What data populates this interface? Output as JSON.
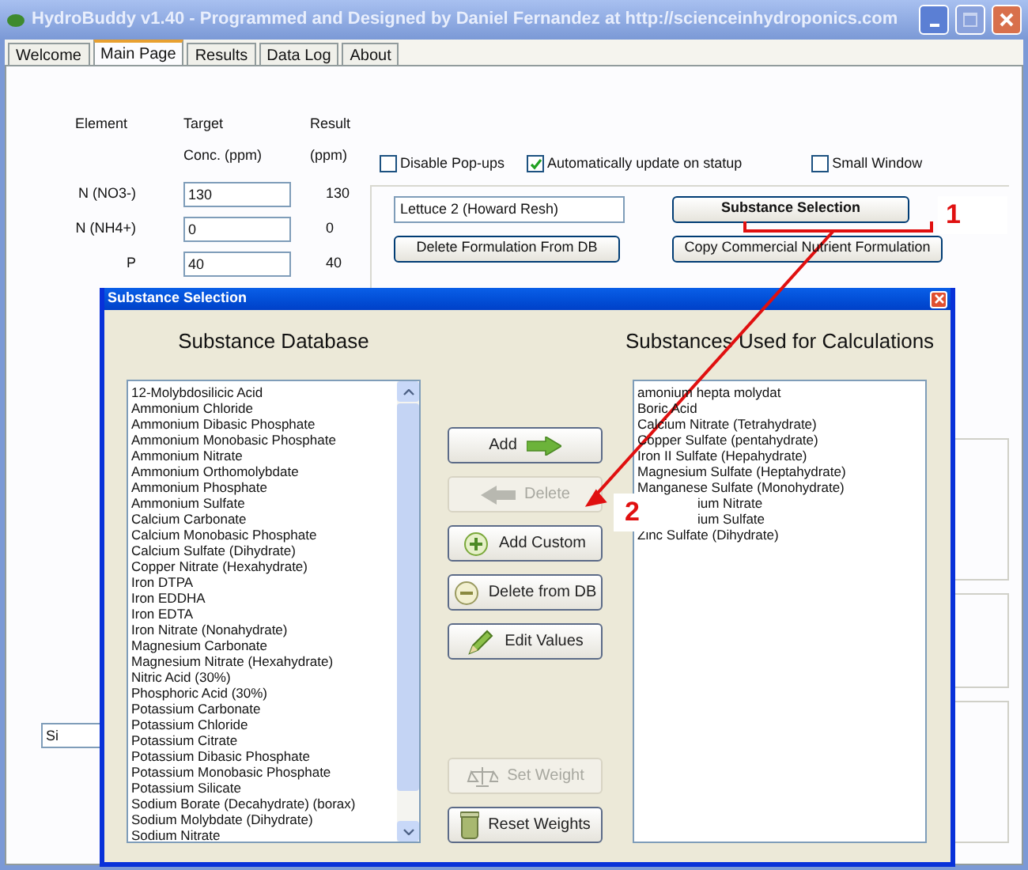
{
  "window": {
    "title": "HydroBuddy v1.40 - Programmed and Designed by Daniel Fernandez at http://scienceinhydroponics.com"
  },
  "tabs": [
    {
      "label": "Welcome",
      "selected": false
    },
    {
      "label": "Main Page",
      "selected": true
    },
    {
      "label": "Results",
      "selected": false
    },
    {
      "label": "Data Log",
      "selected": false
    },
    {
      "label": "About",
      "selected": false
    }
  ],
  "main_page": {
    "columns": [
      {
        "line_1": "Element"
      },
      {
        "line_1": "Target",
        "line_2": "Conc. (ppm)"
      },
      {
        "line_1": "Result",
        "line_2": "(ppm)"
      }
    ],
    "rows": [
      {
        "element": "N (NO3-)",
        "target": "130",
        "result": "130"
      },
      {
        "element": "N (NH4+)",
        "target": "0",
        "result": "0"
      },
      {
        "element": "P",
        "target": "40",
        "result": "40"
      }
    ],
    "extra_field": "Si",
    "checkboxes": [
      {
        "label": "Disable Pop-ups",
        "checked": false
      },
      {
        "label": "Automatically update on statup",
        "checked": true
      },
      {
        "label": "Small Window",
        "checked": false
      }
    ],
    "formulation_name": "Lettuce 2 (Howard Resh)",
    "buttons": [
      {
        "label": "Substance Selection",
        "bold": true
      },
      {
        "label": "Delete Formulation From DB",
        "bold": false
      },
      {
        "label": "Copy Commercial Nutrient Formulation",
        "bold": false
      }
    ]
  },
  "dialog": {
    "title": "Substance Selection",
    "database": {
      "heading": "Substance Database",
      "items": [
        "12-Molybdosilicic Acid",
        "Ammonium Chloride",
        "Ammonium Dibasic Phosphate",
        "Ammonium Monobasic Phosphate",
        "Ammonium Nitrate",
        "Ammonium Orthomolybdate",
        "Ammonium Phosphate",
        "Ammonium Sulfate",
        "Calcium Carbonate",
        "Calcium Monobasic Phosphate",
        "Calcium Sulfate (Dihydrate)",
        "Copper Nitrate (Hexahydrate)",
        "Iron DTPA",
        "Iron EDDHA",
        "Iron EDTA",
        "Iron Nitrate (Nonahydrate)",
        "Magnesium Carbonate",
        "Magnesium Nitrate (Hexahydrate)",
        "Nitric Acid (30%)",
        "Phosphoric Acid (30%)",
        "Potassium Carbonate",
        "Potassium Chloride",
        "Potassium Citrate",
        "Potassium Dibasic Phosphate",
        "Potassium Monobasic Phosphate",
        "Potassium Silicate",
        "Sodium Borate (Decahydrate) (borax)",
        "Sodium Molybdate (Dihydrate)",
        "Sodium Nitrate"
      ]
    },
    "used": {
      "heading": "Substances Used for Calculations",
      "items": [
        "amonium hepta molydat",
        "Boric Acid",
        "Calcium Nitrate (Tetrahydrate)",
        "Copper Sulfate (pentahydrate)",
        "Iron II Sulfate (Hepahydrate)",
        "Magnesium Sulfate (Heptahydrate)",
        "Manganese Sulfate (Monohydrate)",
        "ium Nitrate",
        "ium Sulfate",
        "Zinc Sulfate (Dihydrate)"
      ]
    },
    "buttons": [
      {
        "label": "Add",
        "kind": "add",
        "disabled": false
      },
      {
        "label": "Delete",
        "kind": "remove",
        "disabled": true
      },
      {
        "label": "Add Custom",
        "kind": "add_custom",
        "disabled": false
      },
      {
        "label": "Delete from DB",
        "kind": "delete_db",
        "disabled": false
      },
      {
        "label": "Edit Values",
        "kind": "edit",
        "disabled": false
      }
    ],
    "bottom_buttons": [
      {
        "label": "Set Weight",
        "kind": "weight",
        "disabled": true
      },
      {
        "label": "Reset Weights",
        "kind": "reset",
        "disabled": false
      }
    ]
  },
  "annotations": [
    {
      "label": "1"
    },
    {
      "label": "2"
    }
  ]
}
